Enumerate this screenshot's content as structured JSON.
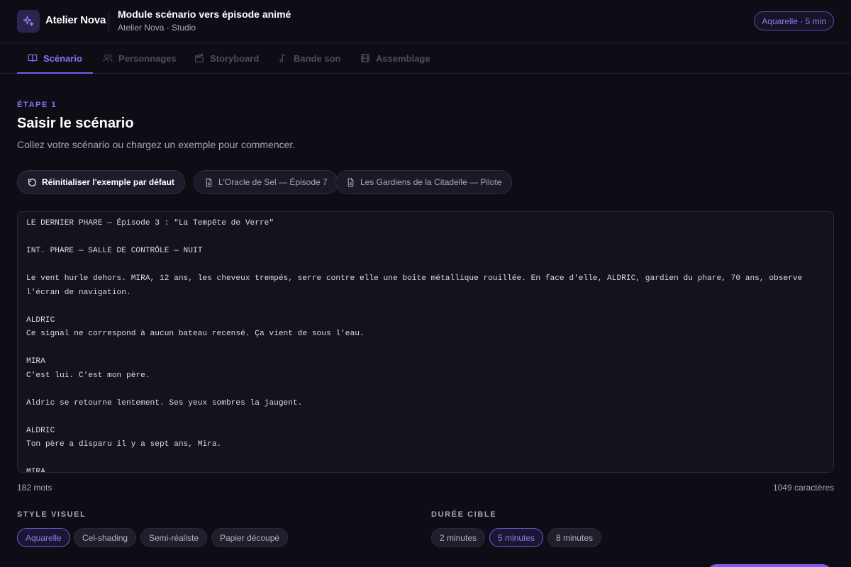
{
  "header": {
    "app_name": "Atelier Nova",
    "title": "Module scénario vers épisode animé",
    "subtitle": "Atelier Nova · Studio",
    "badge": "Aquarelle · 5 min"
  },
  "tabs": [
    {
      "label": "Scénario",
      "icon": "book-icon",
      "active": true
    },
    {
      "label": "Personnages",
      "icon": "users-icon",
      "active": false
    },
    {
      "label": "Storyboard",
      "icon": "clapper-icon",
      "active": false
    },
    {
      "label": "Bande son",
      "icon": "music-note-icon",
      "active": false
    },
    {
      "label": "Assemblage",
      "icon": "film-icon",
      "active": false
    }
  ],
  "step": {
    "label": "ÉTAPE 1",
    "title": "Saisir le scénario",
    "description": "Collez votre scénario ou chargez un exemple pour commencer."
  },
  "actions": {
    "reset_label": "Réinitialiser l'exemple par défaut",
    "examples": [
      "L'Oracle de Sel — Épisode 7",
      "Les Gardiens de la Citadelle — Pilote"
    ]
  },
  "editor": {
    "content": "LE DERNIER PHARE — Épisode 3 : \"La Tempête de Verre\"\n\nINT. PHARE — SALLE DE CONTRÔLE — NUIT\n\nLe vent hurle dehors. MIRA, 12 ans, les cheveux trempés, serre contre elle une boîte métallique rouillée. En face d'elle, ALDRIC, gardien du phare, 70 ans, observe l'écran de navigation.\n\nALDRIC\nCe signal ne correspond à aucun bateau recensé. Ça vient de sous l'eau.\n\nMIRA\nC'est lui. C'est mon père.\n\nAldric se retourne lentement. Ses yeux sombres la jaugent.\n\nALDRIC\nTon père a disparu il y a sept ans, Mira.\n\nMIRA",
    "word_count": "182 mots",
    "char_count": "1049 caractères"
  },
  "style_group": {
    "label": "STYLE VISUEL",
    "options": [
      "Aquarelle",
      "Cel-shading",
      "Semi-réaliste",
      "Papier découpé"
    ],
    "selected": "Aquarelle"
  },
  "duration_group": {
    "label": "DURÉE CIBLE",
    "options": [
      "2 minutes",
      "5 minutes",
      "8 minutes"
    ],
    "selected": "5 minutes"
  },
  "colors": {
    "accent": "#7c5ce8",
    "background": "#0e0d16"
  }
}
